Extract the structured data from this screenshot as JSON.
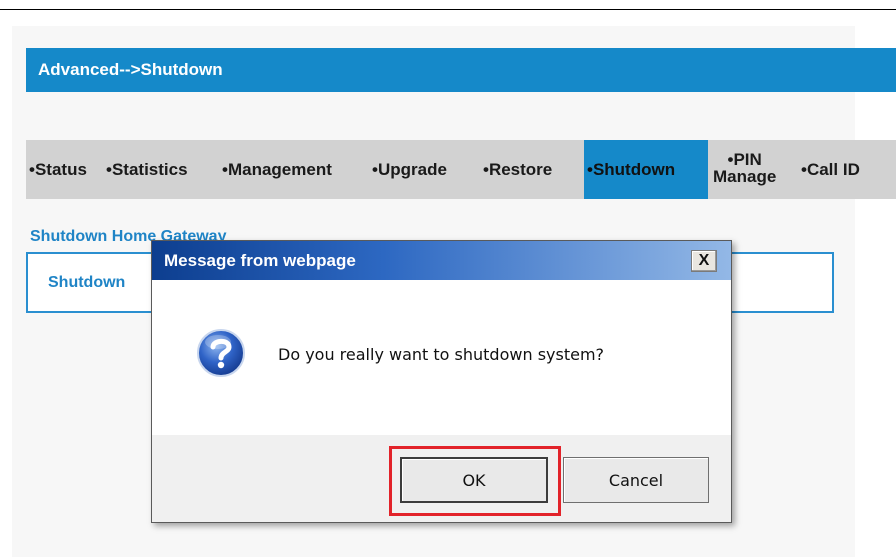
{
  "page": {
    "title": "Advanced-->Shutdown",
    "section_title": "Shutdown Home Gateway",
    "section_box_label": "Shutdown"
  },
  "menu": {
    "items": [
      {
        "label": "•Status"
      },
      {
        "label": "•Statistics"
      },
      {
        "label": "•Management"
      },
      {
        "label": "•Upgrade"
      },
      {
        "label": "•Restore"
      },
      {
        "label": "•Shutdown",
        "active": true
      },
      {
        "label_line1": "•PIN",
        "label_line2": "Manage"
      },
      {
        "label": "•Call ID"
      }
    ]
  },
  "dialog": {
    "title": "Message from webpage",
    "close_label": "X",
    "message": "Do you really want to shutdown system?",
    "ok_label": "OK",
    "cancel_label": "Cancel",
    "icon": "question-icon"
  },
  "colors": {
    "accent": "#1589c9",
    "menu_bg": "#d2d2d2",
    "highlight": "#e2232a",
    "link": "#1f84c6"
  }
}
